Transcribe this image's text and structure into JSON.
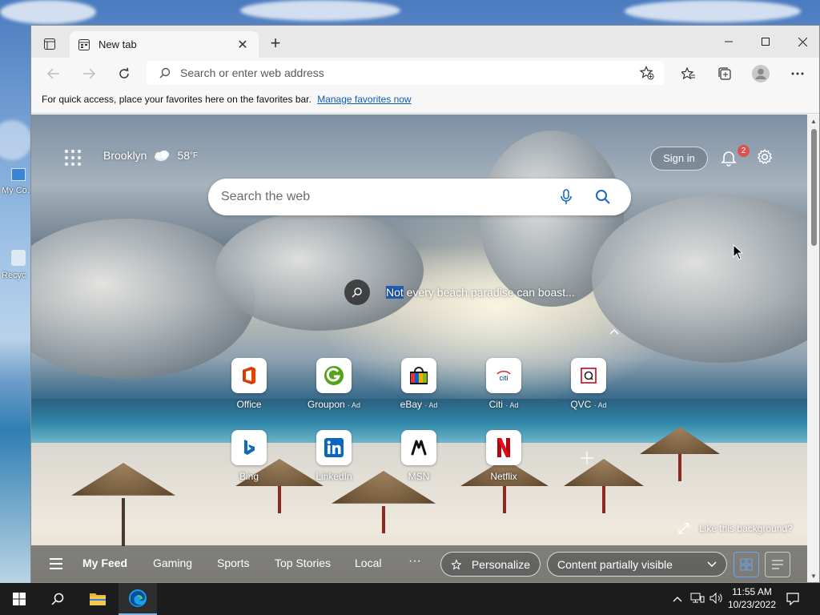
{
  "desktop": {
    "icons": [
      {
        "label": "My Co… - Sho"
      },
      {
        "label": "Recyc"
      }
    ]
  },
  "browser": {
    "tab": {
      "title": "New tab"
    },
    "address": {
      "placeholder": "Search or enter web address"
    },
    "favorites_bar": {
      "message": "For quick access, place your favorites here on the favorites bar.",
      "link": "Manage favorites now"
    }
  },
  "ntp": {
    "weather": {
      "city": "Brooklyn",
      "temp": "58",
      "unit": "°F"
    },
    "sign_in": "Sign in",
    "notifications_count": "2",
    "search": {
      "placeholder": "Search the web"
    },
    "image_caption": {
      "highlight": "Not",
      "rest": " every beach paradise can boast..."
    },
    "tiles": [
      {
        "label": "Office",
        "ad": "",
        "icon": "office-icon",
        "color": "#d83b01"
      },
      {
        "label": "Groupon",
        "ad": "· Ad",
        "icon": "groupon-icon",
        "color": "#53a318"
      },
      {
        "label": "eBay",
        "ad": "· Ad",
        "icon": "ebay-icon",
        "color": "#e53238"
      },
      {
        "label": "Citi",
        "ad": "· Ad",
        "icon": "citi-icon",
        "color": "#003b70"
      },
      {
        "label": "QVC",
        "ad": "· Ad",
        "icon": "qvc-icon",
        "color": "#d0021b"
      },
      {
        "label": "Bing",
        "ad": "",
        "icon": "bing-icon",
        "color": "#0f6cbd"
      },
      {
        "label": "LinkedIn",
        "ad": "",
        "icon": "linkedin-icon",
        "color": "#0a66c2"
      },
      {
        "label": "MSN",
        "ad": "",
        "icon": "msn-icon",
        "color": "#111111"
      },
      {
        "label": "Netflix",
        "ad": "",
        "icon": "netflix-icon",
        "color": "#e50914"
      }
    ],
    "like_background": "Like this background?",
    "feed": {
      "items": [
        "My Feed",
        "Gaming",
        "Sports",
        "Top Stories",
        "Local"
      ],
      "more": "···",
      "personalize": "Personalize",
      "visibility": "Content partially visible"
    }
  },
  "taskbar": {
    "time": "11:55 AM",
    "date": "10/23/2022"
  }
}
